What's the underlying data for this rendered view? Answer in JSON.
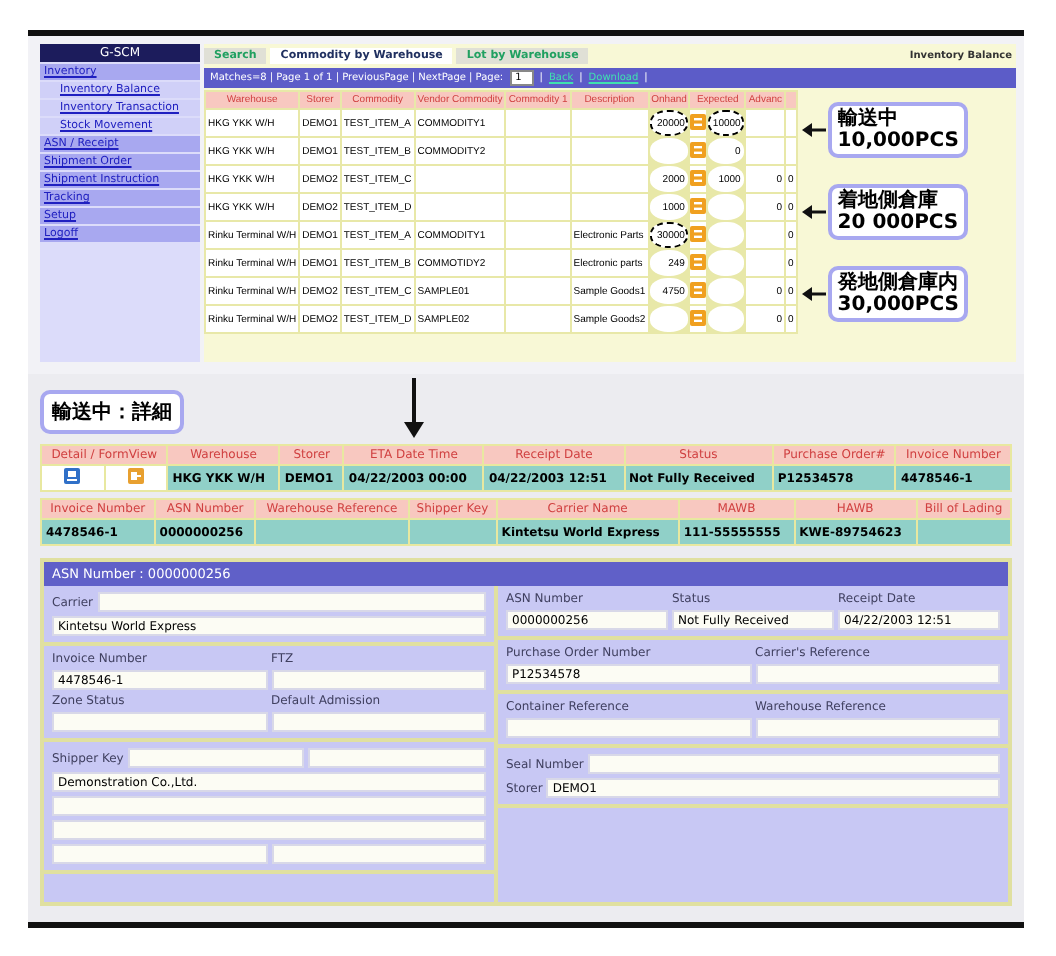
{
  "sidebar": {
    "title": "G-SCM",
    "items": [
      {
        "label": "Inventory",
        "children": [
          {
            "label": "Inventory Balance"
          },
          {
            "label": "Inventory Transaction"
          },
          {
            "label": "Stock Movement"
          }
        ]
      },
      {
        "label": "ASN / Receipt"
      },
      {
        "label": "Shipment Order"
      },
      {
        "label": "Shipment Instruction"
      },
      {
        "label": "Tracking"
      },
      {
        "label": "Setup"
      },
      {
        "label": "Logoff"
      }
    ]
  },
  "tabs": [
    {
      "label": "Search",
      "selected": false
    },
    {
      "label": "Commodity by Warehouse",
      "selected": true
    },
    {
      "label": "Lot by Warehouse",
      "selected": false
    }
  ],
  "page_title": "Inventory Balance",
  "pager": [
    {
      "kind": "text",
      "text": "Matches=8 | Page 1 of 1 | PreviousPage | NextPage | Page:"
    },
    {
      "kind": "select",
      "text": "1"
    },
    {
      "kind": "text",
      "text": "|"
    },
    {
      "kind": "link",
      "text": "Back"
    },
    {
      "kind": "text",
      "text": "|"
    },
    {
      "kind": "link",
      "text": "Download"
    },
    {
      "kind": "text",
      "text": "|"
    }
  ],
  "table": {
    "columns": [
      "Warehouse",
      "Storer",
      "Commodity",
      "Vendor Commodity",
      "Commodity 1",
      "Description",
      "Onhand",
      "Expected",
      "Advanc",
      null
    ],
    "rows": [
      {
        "cells": [
          "HKG YKK W/H",
          "DEMO1",
          "TEST_ITEM_A",
          "COMMODITY1",
          null,
          null,
          "20000",
          "10000",
          null,
          null
        ],
        "onhand_circled": true,
        "expected_circled": true
      },
      {
        "cells": [
          "HKG YKK W/H",
          "DEMO1",
          "TEST_ITEM_B",
          "COMMODITY2",
          null,
          null,
          null,
          "0",
          null,
          null
        ],
        "onhand_circled": false,
        "expected_circled": false
      },
      {
        "cells": [
          "HKG YKK W/H",
          "DEMO2",
          "TEST_ITEM_C",
          null,
          null,
          null,
          "2000",
          "1000",
          "0",
          "0"
        ],
        "onhand_circled": false,
        "expected_circled": false
      },
      {
        "cells": [
          "HKG YKK W/H",
          "DEMO2",
          "TEST_ITEM_D",
          null,
          null,
          null,
          "1000",
          null,
          "0",
          "0"
        ],
        "onhand_circled": false,
        "expected_circled": false
      },
      {
        "cells": [
          "Rinku Terminal W/H",
          "DEMO1",
          "TEST_ITEM_A",
          "COMMODITY1",
          null,
          "Electronic Parts",
          "30000",
          null,
          null,
          "0"
        ],
        "onhand_circled": true,
        "expected_circled": false
      },
      {
        "cells": [
          "Rinku Terminal W/H",
          "DEMO1",
          "TEST_ITEM_B",
          "COMMOTIDY2",
          null,
          "Electronic parts",
          "249",
          null,
          null,
          "0"
        ],
        "onhand_circled": false,
        "expected_circled": false
      },
      {
        "cells": [
          "Rinku Terminal W/H",
          "DEMO2",
          "TEST_ITEM_C",
          "SAMPLE01",
          null,
          "Sample Goods1",
          "4750",
          null,
          "0",
          "0"
        ],
        "onhand_circled": false,
        "expected_circled": false
      },
      {
        "cells": [
          "Rinku Terminal W/H",
          "DEMO2",
          "TEST_ITEM_D",
          "SAMPLE02",
          null,
          "Sample Goods2",
          null,
          null,
          "0",
          "0"
        ],
        "onhand_circled": false,
        "expected_circled": false
      }
    ]
  },
  "callouts": [
    {
      "lines": [
        "輸送中",
        "10,000PCS"
      ]
    },
    {
      "lines": [
        "着地側倉庫",
        "20 000PCS"
      ]
    },
    {
      "lines": [
        "発地側倉庫内",
        "30,000PCS"
      ]
    }
  ],
  "detail_callout": "輸送中：詳細",
  "detail_table": {
    "columns": [
      "Detail / FormView",
      "Warehouse",
      "Storer",
      "ETA Date Time",
      "Receipt Date",
      "Status",
      "Purchase Order#",
      "Invoice Number"
    ],
    "cells": [
      "HKG YKK W/H",
      "DEMO1",
      "04/22/2003 00:00",
      "04/22/2003 12:51",
      "Not Fully Received",
      "P12534578",
      "4478546-1"
    ]
  },
  "shipment_table": {
    "columns": [
      "Invoice Number",
      "ASN Number",
      "Warehouse Reference",
      "Shipper Key",
      "Carrier Name",
      "MAWB",
      "HAWB",
      "Bill of Lading"
    ],
    "cells": [
      "4478546-1",
      "0000000256",
      null,
      null,
      "Kintetsu World Express",
      "111-55555555",
      "KWE-89754623",
      null
    ]
  },
  "asn": {
    "title": "ASN Number : 0000000256",
    "left": [
      {
        "rows": [
          [
            {
              "kind": "label",
              "text": "Carrier"
            },
            {
              "kind": "field"
            }
          ],
          [
            {
              "kind": "field",
              "value": "Kintetsu World Express"
            }
          ]
        ]
      },
      {
        "rows": [
          [
            {
              "kind": "label",
              "text": "Invoice Number"
            },
            {
              "kind": "label",
              "text": "FTZ"
            }
          ],
          [
            {
              "kind": "field",
              "value": "4478546-1"
            },
            {
              "kind": "field"
            }
          ],
          [
            {
              "kind": "label",
              "text": "Zone Status"
            },
            {
              "kind": "label",
              "text": "Default Admission"
            }
          ],
          [
            {
              "kind": "field"
            },
            {
              "kind": "field"
            }
          ]
        ]
      },
      {
        "rows": [
          [
            {
              "kind": "label",
              "text": "Shipper Key"
            },
            {
              "kind": "field"
            },
            {
              "kind": "field"
            }
          ],
          [
            {
              "kind": "field",
              "value": "Demonstration Co.,Ltd."
            }
          ],
          [
            {
              "kind": "field"
            }
          ],
          [
            {
              "kind": "field"
            }
          ],
          [
            {
              "kind": "field"
            },
            {
              "kind": "field"
            }
          ]
        ]
      }
    ],
    "right": [
      {
        "rows": [
          [
            {
              "kind": "label",
              "text": "ASN Number"
            },
            {
              "kind": "label",
              "text": "Status"
            },
            {
              "kind": "label",
              "text": "Receipt Date"
            }
          ],
          [
            {
              "kind": "field",
              "value": "0000000256"
            },
            {
              "kind": "field",
              "value": "Not Fully Received"
            },
            {
              "kind": "field",
              "value": "04/22/2003 12:51"
            }
          ]
        ]
      },
      {
        "rows": [
          [
            {
              "kind": "label",
              "text": "Purchase Order Number"
            },
            {
              "kind": "label",
              "text": "Carrier's Reference"
            }
          ],
          [
            {
              "kind": "field",
              "value": "P12534578"
            },
            {
              "kind": "field"
            }
          ]
        ]
      },
      {
        "rows": [
          [
            {
              "kind": "label",
              "text": "Container Reference"
            },
            {
              "kind": "label",
              "text": "Warehouse Reference"
            }
          ],
          [
            {
              "kind": "field"
            },
            {
              "kind": "field"
            }
          ]
        ]
      },
      {
        "rows": [
          [
            {
              "kind": "label",
              "text": "Seal Number"
            },
            {
              "kind": "field"
            }
          ],
          [
            {
              "kind": "label",
              "text": "Storer"
            },
            {
              "kind": "field",
              "value": "DEMO1"
            }
          ]
        ]
      }
    ]
  }
}
